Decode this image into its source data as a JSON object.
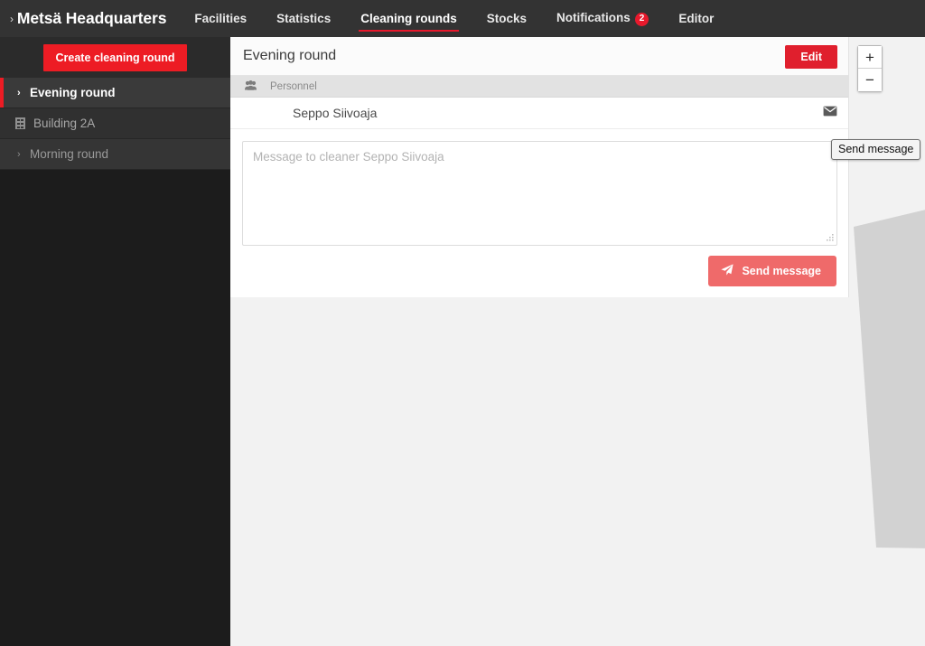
{
  "topnav": {
    "brand": "Metsä Headquarters",
    "brand_caret": "›",
    "items": [
      {
        "label": "Facilities",
        "active": false
      },
      {
        "label": "Statistics",
        "active": false
      },
      {
        "label": "Cleaning rounds",
        "active": true
      },
      {
        "label": "Stocks",
        "active": false
      },
      {
        "label": "Notifications",
        "active": false,
        "badge": "2"
      },
      {
        "label": "Editor",
        "active": false
      }
    ],
    "notifications_badge": "2"
  },
  "sidebar": {
    "create_button": "Create cleaning round",
    "tree": [
      {
        "label": "Evening round",
        "caret": "›",
        "selected": true,
        "icon": "chevron-right-icon"
      },
      {
        "label": "Building 2A",
        "selected": false,
        "icon": "building-icon"
      },
      {
        "label": "Morning round",
        "caret": "›",
        "selected": false,
        "icon": "chevron-right-icon"
      }
    ]
  },
  "panel": {
    "title": "Evening round",
    "edit_button": "Edit",
    "table": {
      "icon": "people-icon",
      "columns": [
        "Personnel"
      ],
      "rows": [
        {
          "name": "Seppo Siivoaja",
          "action_icon": "envelope-icon"
        }
      ]
    },
    "message": {
      "placeholder": "Message to cleaner Seppo Siivoaja",
      "value": "",
      "send_button": "Send message",
      "send_icon": "paper-plane-icon"
    }
  },
  "map_controls": {
    "zoom_in": "+",
    "zoom_out": "−"
  },
  "tooltip": {
    "text": "Send message"
  },
  "colors": {
    "brand_red": "#ed1c24",
    "edit_red": "#e01f2d",
    "send_coral": "#ef6a6a",
    "nav_dark": "#333333",
    "sidebar_dark": "#1c1c1c",
    "map_grey": "#f2f2f2",
    "building_grey": "#d2d2d2"
  }
}
